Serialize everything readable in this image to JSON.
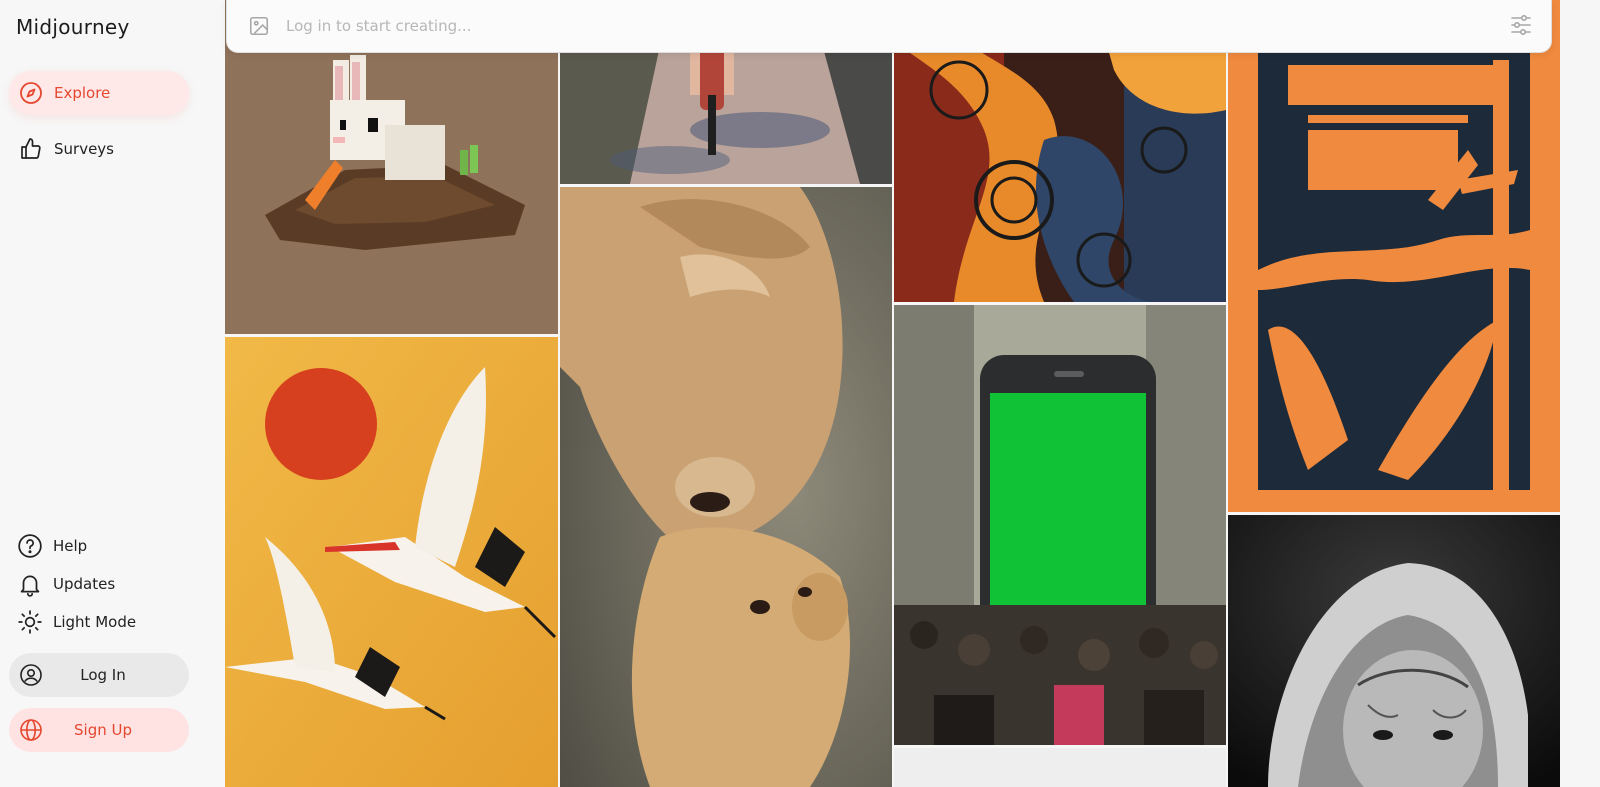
{
  "app": {
    "brand": "Midjourney"
  },
  "nav": {
    "items": [
      {
        "label": "Explore",
        "icon": "compass-icon",
        "active": true
      },
      {
        "label": "Surveys",
        "icon": "thumbs-up-icon",
        "active": false
      }
    ]
  },
  "utility": {
    "items": [
      {
        "label": "Help",
        "icon": "help-circle-icon"
      },
      {
        "label": "Updates",
        "icon": "bell-icon"
      },
      {
        "label": "Light Mode",
        "icon": "sun-icon"
      }
    ]
  },
  "auth": {
    "login_label": "Log In",
    "signup_label": "Sign Up"
  },
  "prompt": {
    "placeholder": "Log in to start creating..."
  },
  "gallery": {
    "images": [
      {
        "subject": "pixel-art white rabbit with carrot on dirt mound"
      },
      {
        "subject": "cyclist riding down tree-shaded road"
      },
      {
        "subject": "abstract orange and blue swirl painting"
      },
      {
        "subject": "orange and navy tropical linocut print"
      },
      {
        "subject": "two red-crowned cranes flying past red sun on gold"
      },
      {
        "subject": "lioness nuzzling lion cub"
      },
      {
        "subject": "giant green-screen smartphone above street crowd"
      },
      {
        "subject": "black and white portrait of hooded woman with face tattoo"
      }
    ]
  },
  "colors": {
    "accent": "#e5472f",
    "accent_bg": "#ffe8e8",
    "sidebar_bg": "#f7f7f7"
  }
}
